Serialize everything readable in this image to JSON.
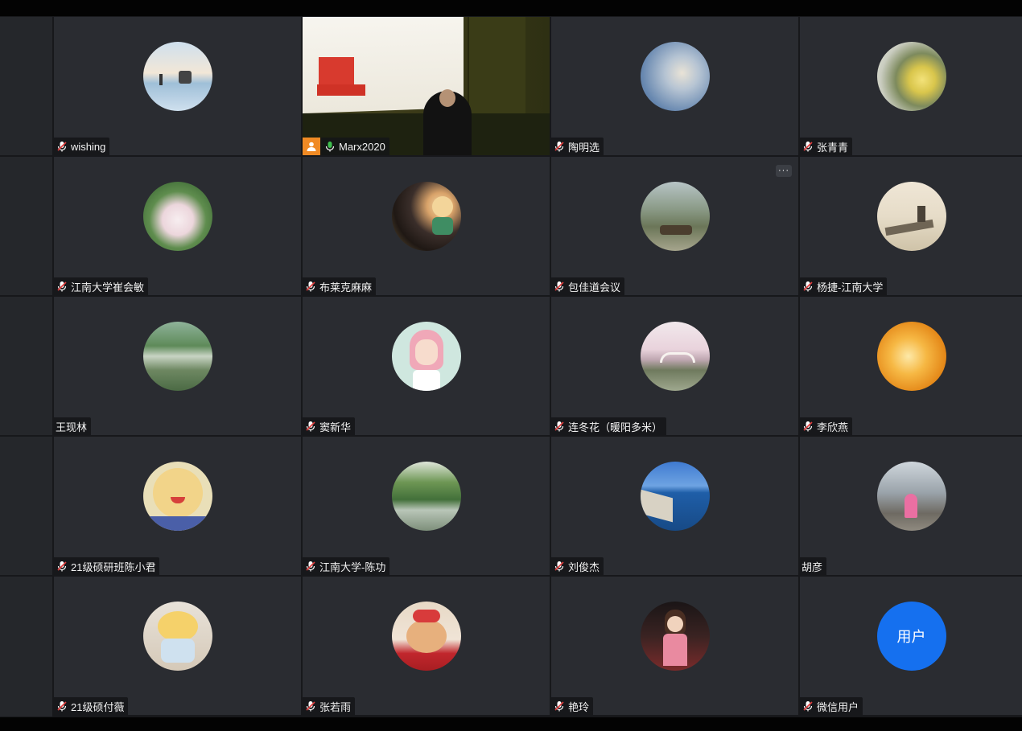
{
  "participants": [
    {
      "name": "wishing",
      "muted": true,
      "avatar": "reflection-landscape"
    },
    {
      "name": "Marx2020",
      "muted": false,
      "speaking": true,
      "video": true
    },
    {
      "name": "陶明选",
      "muted": true,
      "avatar": "sky-clouds"
    },
    {
      "name": "张青青",
      "muted": true,
      "avatar": "yellow-flowers"
    },
    {
      "name": "江南大学崔会敏",
      "muted": true,
      "avatar": "lotus-flower"
    },
    {
      "name": "布莱克麻麻",
      "muted": true,
      "avatar": "toy-figure"
    },
    {
      "name": "包佳道会议",
      "muted": true,
      "avatar": "camels-landscape",
      "has_more_menu": true
    },
    {
      "name": "杨捷-江南大学",
      "muted": true,
      "avatar": "ink-painting"
    },
    {
      "name": "王现林",
      "muted": null,
      "avatar": "lake-trees"
    },
    {
      "name": "窦新华",
      "muted": true,
      "avatar": "cartoon-girl"
    },
    {
      "name": "连冬花（暖阳多米）",
      "muted": true,
      "avatar": "bridge-blossoms"
    },
    {
      "name": "李欣燕",
      "muted": true,
      "avatar": "golden-abstract"
    },
    {
      "name": "21级硕研班陈小君",
      "muted": true,
      "avatar": "smiling-face"
    },
    {
      "name": "江南大学-陈功",
      "muted": true,
      "avatar": "river-plants"
    },
    {
      "name": "刘俊杰",
      "muted": true,
      "avatar": "sea-cliff"
    },
    {
      "name": "胡彦",
      "muted": null,
      "avatar": "child-street"
    },
    {
      "name": "21级硕付薇",
      "muted": true,
      "avatar": "pompompurin-plush"
    },
    {
      "name": "张若雨",
      "muted": true,
      "avatar": "cat-hat"
    },
    {
      "name": "艳玲",
      "muted": true,
      "avatar": "anime-girl"
    },
    {
      "name": "微信用户",
      "muted": true,
      "avatar_text": "用户",
      "avatar_color": "#1570ef"
    }
  ],
  "colors": {
    "active_border": "#3fbf4f",
    "tile_bg": "#2a2c31",
    "mic_muted": "#ffffff",
    "mic_active": "#3fbf4f"
  },
  "more_menu_label": "···"
}
